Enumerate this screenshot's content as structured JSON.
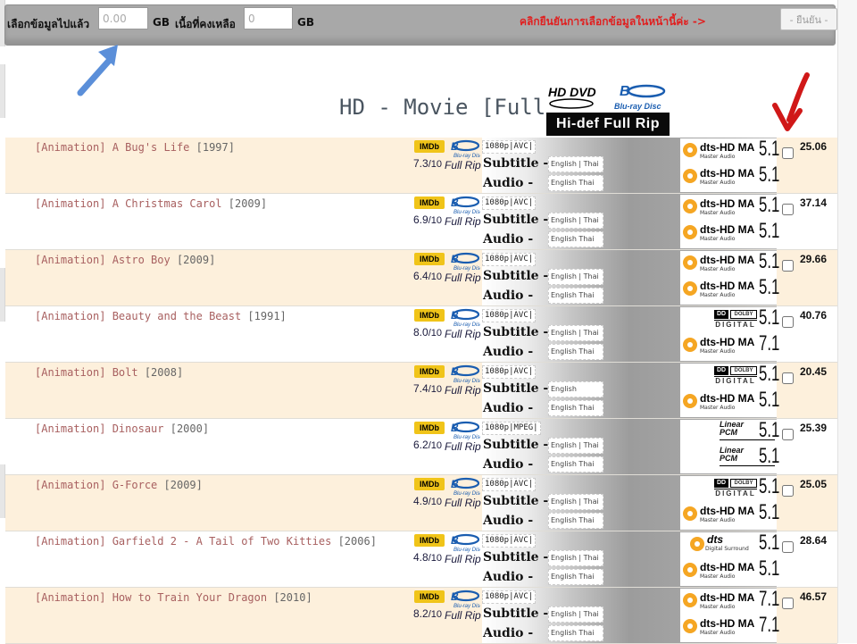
{
  "toolbar": {
    "selected_label": "เลือกข้อมูลไปแล้ว",
    "selected_value": "0.00",
    "gb_unit_1": "GB",
    "remaining_label": "เนื้อที่คงเหลือ",
    "remaining_value": "0",
    "gb_unit_2": "GB",
    "confirm_hint": "คลิกยืนยันการเลือกข้อมูลในหน้านี้ค่ะ ->",
    "confirm_button": "- ยืนยัน -"
  },
  "section": {
    "title": "HD - Movie [Full BD]",
    "logo_bottom": "Hi-def Full Rip",
    "logo_hd": "HD DVD",
    "logo_bd": "Blu-ray Disc"
  },
  "badge_text": {
    "imdb": "IMDb",
    "full_rip": "Full Rip",
    "subtitle_label": "Subtitle -",
    "audio_label": "Audio -",
    "rating_suffix": "/10",
    "bluray_small": "Blu-ray Disc"
  },
  "colors": {
    "toolbar_bg": "#a8a8a8",
    "row_odd_bg": "#fdf0dc",
    "row_even_bg": "#ffffff",
    "title_color": "#a86060",
    "imdb_yellow": "#f0c419",
    "bluray_blue": "#1a5db0",
    "confirm_red": "#e02020",
    "arrow_blue": "#5b8fd9",
    "arrow_red": "#d01818"
  },
  "movies": [
    {
      "title": "[Animation] A Bug's Life",
      "year": "[1997]",
      "rating": "7.3",
      "codec": "1080p|AVC|",
      "subtitle": "English | Thai",
      "audio": "English Thai",
      "size": "25.06",
      "audio_logos": [
        {
          "kind": "dts-hd",
          "name": "dts-HD MA",
          "sub": "Master Audio",
          "channels": "5.1"
        },
        {
          "kind": "dts-hd",
          "name": "dts-HD MA",
          "sub": "Master Audio",
          "channels": "5.1"
        }
      ]
    },
    {
      "title": "[Animation] A Christmas Carol",
      "year": "[2009]",
      "rating": "6.9",
      "codec": "1080p|AVC|",
      "subtitle": "English | Thai",
      "audio": "English Thai",
      "size": "37.14",
      "audio_logos": [
        {
          "kind": "dts-hd",
          "name": "dts-HD MA",
          "sub": "Master Audio",
          "channels": "5.1"
        },
        {
          "kind": "dts-hd",
          "name": "dts-HD MA",
          "sub": "Master Audio",
          "channels": "5.1"
        }
      ]
    },
    {
      "title": "[Animation] Astro Boy",
      "year": "[2009]",
      "rating": "6.4",
      "codec": "1080p|AVC|",
      "subtitle": "English | Thai",
      "audio": "English Thai",
      "size": "29.66",
      "audio_logos": [
        {
          "kind": "dts-hd",
          "name": "dts-HD MA",
          "sub": "Master Audio",
          "channels": "5.1"
        },
        {
          "kind": "dts-hd",
          "name": "dts-HD MA",
          "sub": "Master Audio",
          "channels": "5.1"
        }
      ]
    },
    {
      "title": "[Animation] Beauty and the Beast",
      "year": "[1991]",
      "rating": "8.0",
      "codec": "1080p|AVC|",
      "subtitle": "English | Thai",
      "audio": "English Thai",
      "size": "40.76",
      "audio_logos": [
        {
          "kind": "dolby",
          "name": "DOLBY",
          "sub": "DIGITAL",
          "channels": "5.1"
        },
        {
          "kind": "dts-hd",
          "name": "dts-HD MA",
          "sub": "Master Audio",
          "channels": "7.1"
        }
      ]
    },
    {
      "title": "[Animation] Bolt",
      "year": "[2008]",
      "rating": "7.4",
      "codec": "1080p|AVC|",
      "subtitle": "English",
      "audio": "English Thai",
      "size": "20.45",
      "audio_logos": [
        {
          "kind": "dolby",
          "name": "DOLBY",
          "sub": "DIGITAL",
          "channels": "5.1"
        },
        {
          "kind": "dts-hd",
          "name": "dts-HD MA",
          "sub": "Master Audio",
          "channels": "5.1"
        }
      ]
    },
    {
      "title": "[Animation] Dinosaur",
      "year": "[2000]",
      "rating": "6.2",
      "codec": "1080p|MPEG|",
      "subtitle": "English | Thai",
      "audio": "English Thai",
      "size": "25.39",
      "audio_logos": [
        {
          "kind": "lpcm",
          "name": "Linear PCM",
          "sub": "",
          "channels": "5.1"
        },
        {
          "kind": "lpcm",
          "name": "Linear PCM",
          "sub": "",
          "channels": "5.1"
        }
      ]
    },
    {
      "title": "[Animation] G-Force",
      "year": "[2009]",
      "rating": "4.9",
      "codec": "1080p|AVC|",
      "subtitle": "English | Thai",
      "audio": "English Thai",
      "size": "25.05",
      "audio_logos": [
        {
          "kind": "dolby",
          "name": "DOLBY",
          "sub": "DIGITAL",
          "channels": "5.1"
        },
        {
          "kind": "dts-hd",
          "name": "dts-HD MA",
          "sub": "Master Audio",
          "channels": "5.1"
        }
      ]
    },
    {
      "title": "[Animation] Garfield 2 - A Tail of Two Kitties",
      "year": "[2006]",
      "rating": "4.8",
      "codec": "1080p|AVC|",
      "subtitle": "English | Thai",
      "audio": "English Thai",
      "size": "28.64",
      "audio_logos": [
        {
          "kind": "dts",
          "name": "dts",
          "sub": "Digital Surround",
          "channels": "5.1"
        },
        {
          "kind": "dts-hd",
          "name": "dts-HD MA",
          "sub": "Master Audio",
          "channels": "5.1"
        }
      ]
    },
    {
      "title": "[Animation] How to Train Your Dragon",
      "year": "[2010]",
      "rating": "8.2",
      "codec": "1080p|AVC|",
      "subtitle": "English | Thai",
      "audio": "English Thai",
      "size": "46.57",
      "audio_logos": [
        {
          "kind": "dts-hd",
          "name": "dts-HD MA",
          "sub": "Master Audio",
          "channels": "7.1"
        },
        {
          "kind": "dts-hd",
          "name": "dts-HD MA",
          "sub": "Master Audio",
          "channels": "7.1"
        }
      ]
    }
  ]
}
